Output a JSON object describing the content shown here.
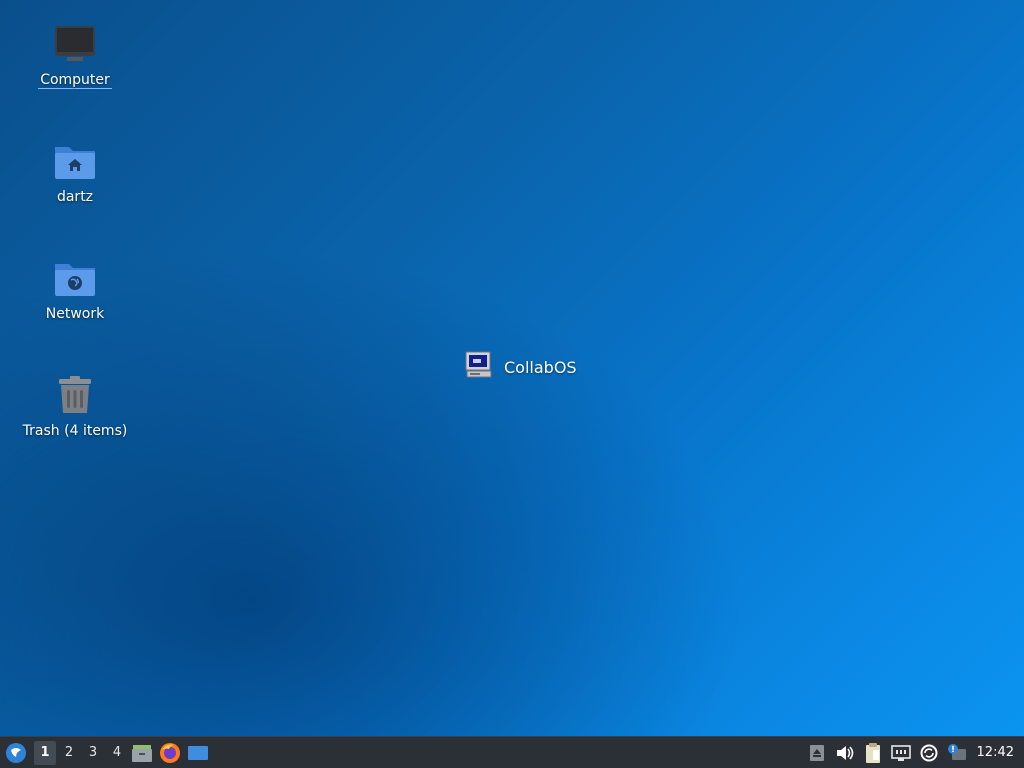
{
  "desktop": {
    "icons": [
      {
        "label": "Computer",
        "icon": "computer-icon"
      },
      {
        "label": "dartz",
        "icon": "home-folder-icon"
      },
      {
        "label": "Network",
        "icon": "network-folder-icon"
      },
      {
        "label": "Trash (4 items)",
        "icon": "trash-icon"
      }
    ],
    "app": {
      "label": "CollabOS",
      "icon": "collabos-monitor-icon"
    }
  },
  "taskbar": {
    "workspaces": [
      "1",
      "2",
      "3",
      "4"
    ],
    "active_workspace": "1",
    "launchers": [
      "file-manager-icon",
      "firefox-icon",
      "show-desktop-icon"
    ],
    "tray_icons": [
      "eject-icon",
      "volume-icon",
      "clipboard-icon",
      "network-wired-icon",
      "update-icon",
      "notification-icon"
    ],
    "clock": "12:42"
  },
  "colors": {
    "taskbar_bg": "#2b3037",
    "desktop_top": "#0a4f8c",
    "desktop_bottom": "#0b95f2",
    "folder_blue": "#4f8fe0"
  }
}
